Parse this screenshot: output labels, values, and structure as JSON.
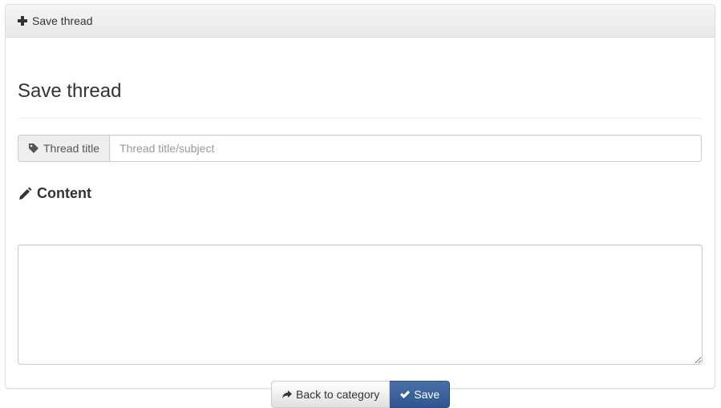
{
  "panel": {
    "heading_label": "Save thread"
  },
  "form": {
    "title": "Save thread",
    "thread_title": {
      "addon_label": "Thread title",
      "placeholder": "Thread title/subject",
      "value": ""
    },
    "content": {
      "label": "Content",
      "value": ""
    },
    "buttons": {
      "back_label": "Back to category",
      "save_label": "Save"
    }
  },
  "icons": {
    "heading": "plus-icon",
    "thread_title": "tag-icon",
    "content": "pencil-icon",
    "back": "share-arrow-icon",
    "save": "checkmark-icon"
  },
  "colors": {
    "primary_button": "#3a5f9a",
    "panel_heading_bg": "#eeeeee",
    "border": "#cccccc"
  }
}
